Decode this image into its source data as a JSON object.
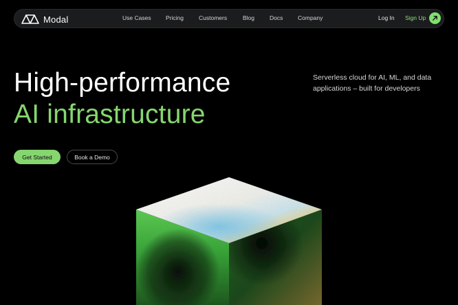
{
  "nav": {
    "brand": "Modal",
    "links": [
      "Use Cases",
      "Pricing",
      "Customers",
      "Blog",
      "Docs",
      "Company"
    ],
    "login": "Log In",
    "signup": "Sign Up"
  },
  "hero": {
    "title_line1": "High-performance",
    "title_line2": "AI infrastructure",
    "subtitle": "Serverless cloud for AI, ML, and data applications – built for developers"
  },
  "cta": {
    "primary": "Get Started",
    "secondary": "Book a Demo"
  },
  "colors": {
    "accent": "#86d66f",
    "background": "#000000",
    "nav_bg": "#1b1c1e"
  },
  "icons": {
    "logo": "modal-logo-icon",
    "signup": "arrow-up-right-icon"
  }
}
